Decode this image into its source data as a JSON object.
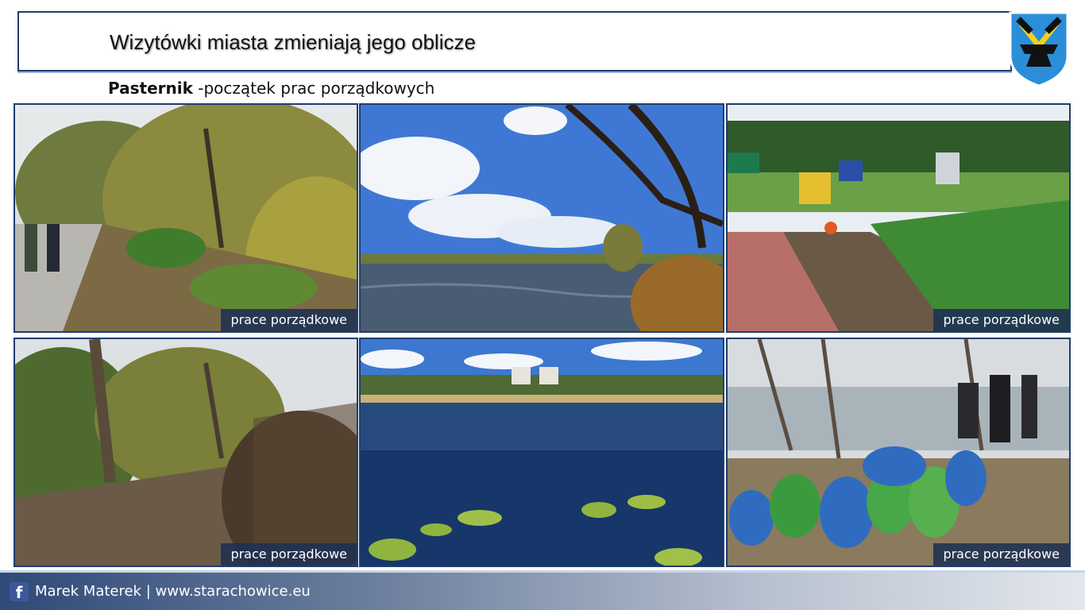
{
  "header": {
    "title": "Wizytówki miasta zmieniają jego oblicze"
  },
  "subtitle": {
    "bold": "Pasternik",
    "rest": " -początek prac porządkowych"
  },
  "photos": [
    {
      "caption": "prace porządkowe"
    },
    {
      "caption": ""
    },
    {
      "caption": "prace porządkowe"
    },
    {
      "caption": "prace porządkowe"
    },
    {
      "caption": ""
    },
    {
      "caption": "prace porządkowe"
    }
  ],
  "footer": {
    "icon": "facebook-icon",
    "text": "Marek Materek | www.starachowice.eu"
  },
  "colors": {
    "frame": "#1f3d6e",
    "caption_bg": "#1e3052",
    "crest_blue": "#2a8fd8",
    "crest_yellow": "#f2d21c"
  }
}
